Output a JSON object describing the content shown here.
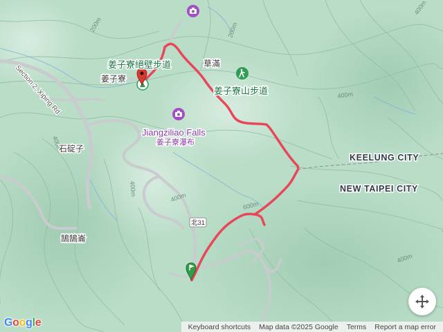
{
  "map": {
    "labels": {
      "trail_top": "姜子寮絕壁步道",
      "caoman": "草滿",
      "trail_right": "姜子寮山步道",
      "jiangziliao": "姜子寮",
      "falls_en": "Jiangziliao Falls",
      "falls_zh": "姜子寮瀑布",
      "xipinglu": "Section 2, Xiping Rd",
      "shidingzi": "石碇子",
      "gugumu": "鵠鵠崙",
      "keelung": "KEELUNG CITY",
      "newtaipei": "NEW TAIPEI CITY",
      "road_shield": "北31"
    },
    "contours": [
      "400m",
      "400m",
      "400m",
      "400m",
      "400m",
      "600m",
      "200m",
      "200m",
      "400m"
    ],
    "colors": {
      "terrain": "#b9ddc7",
      "contour": "#93bda6",
      "road": "#c9cbcf",
      "track": "#e8475a",
      "start_marker": "#2f9e44",
      "end_marker": "#d33b32",
      "poi_purple": "#a14fc4",
      "poi_green": "#2f9e55"
    }
  },
  "controls": {
    "recenter_icon": "move-arrows-icon"
  },
  "attribution": {
    "logo": "Google",
    "keyboard": "Keyboard shortcuts",
    "mapdata": "Map data ©2025 Google",
    "terms": "Terms",
    "report": "Report a map error"
  }
}
